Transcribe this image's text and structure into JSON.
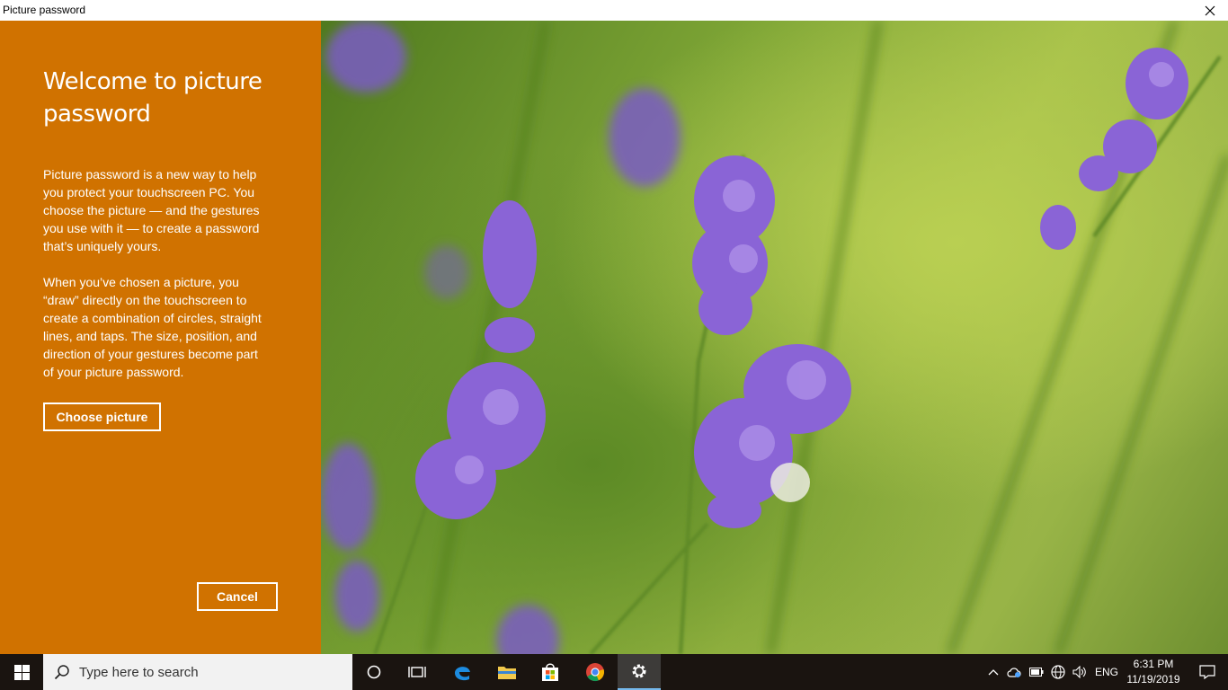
{
  "window": {
    "title": "Picture password"
  },
  "colors": {
    "panel": "#d07200",
    "taskbar": "#1a1410",
    "accent": "#76b9ed"
  },
  "panel": {
    "heading": "Welcome to picture password",
    "paragraph1": "Picture password is a new way to help you protect your touchscreen PC. You choose the picture — and the gestures you use with it — to create a password that’s uniquely yours.",
    "paragraph2": "When you’ve chosen a picture, you “draw” directly on the touchscreen to create a combination of circles, straight lines, and taps. The size, position, and direction of your gestures become part of your picture password.",
    "choose_label": "Choose picture",
    "cancel_label": "Cancel"
  },
  "taskbar": {
    "search_placeholder": "Type here to search",
    "apps": [
      "cortana-icon",
      "task-view-icon",
      "edge-icon",
      "file-explorer-icon",
      "store-icon",
      "chrome-icon",
      "settings-icon"
    ],
    "language": "ENG",
    "time": "6:31 PM",
    "date": "11/19/2019"
  }
}
